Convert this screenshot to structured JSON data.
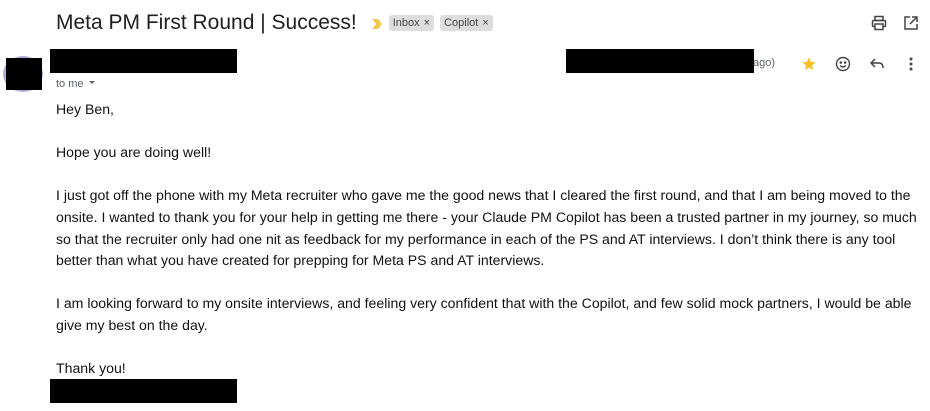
{
  "email": {
    "subject": "Meta PM First Round | Success!",
    "labels": [
      {
        "name": "Inbox",
        "remove": "×"
      },
      {
        "name": "Copilot",
        "remove": "×"
      }
    ],
    "time_fragment": "ago)",
    "recipient": "to me",
    "body": {
      "greeting": "Hey Ben,",
      "p1": "Hope you are doing well!",
      "p2": "I just got off the phone with my Meta recruiter who gave me the good news that I cleared the first round, and that I am being moved to the onsite. I wanted to thank you for your help in getting me there - your Claude PM Copilot has been a trusted partner in my journey, so much so that the recruiter only had one nit as feedback for my performance in each of the PS and AT interviews. I don’t think there is any tool better than what you have created for prepping for Meta PS and AT interviews.",
      "p3": "I am looking forward to my onsite interviews, and feeling very confident that with the Copilot, and few solid mock partners, I would be able give my best on the day.",
      "closing": "Thank you!"
    }
  },
  "icons": {
    "importance": "importance-marker-icon",
    "print": "print-icon",
    "open_new_window": "open-in-new-window-icon",
    "star": "star-icon",
    "emoji": "emoji-reaction-icon",
    "reply": "reply-icon",
    "more": "more-vert-icon",
    "dropdown": "chevron-down-icon"
  },
  "colors": {
    "importance": "#f2c94c",
    "star": "#f6bf26",
    "label_bg": "#dddddd",
    "redaction": "#000000"
  }
}
